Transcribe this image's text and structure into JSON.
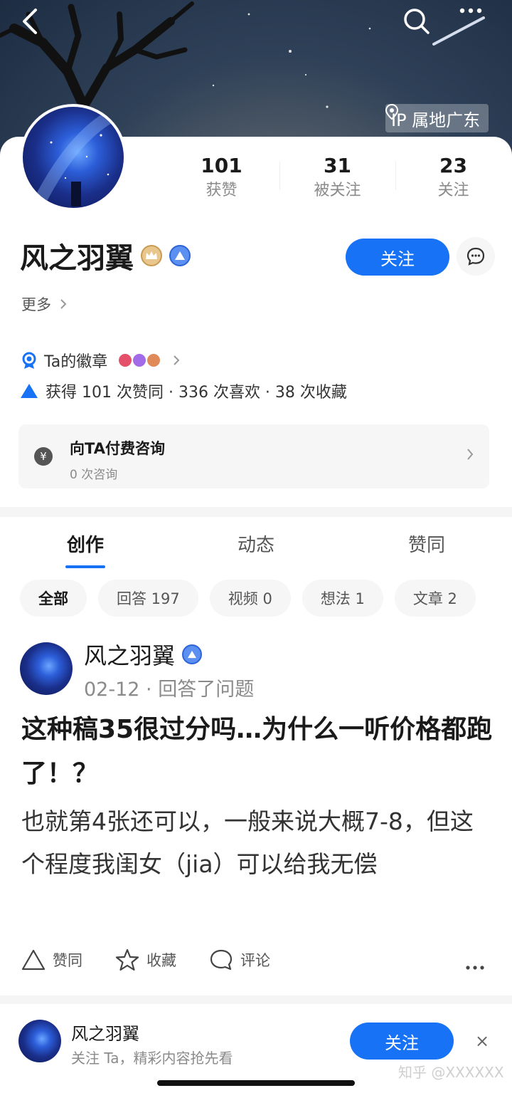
{
  "header": {
    "ip_location": "IP 属地广东"
  },
  "profile": {
    "name": "风之羽翼",
    "stats": [
      {
        "num": "101",
        "label": "获赞"
      },
      {
        "num": "31",
        "label": "被关注"
      },
      {
        "num": "23",
        "label": "关注"
      }
    ],
    "follow_label": "关注",
    "more_label": "更多"
  },
  "badges": {
    "label": "Ta的徽章",
    "stats_line": "获得 101 次赞同 · 336 次喜欢 · 38 次收藏",
    "badge_colors": [
      "#e4506a",
      "#a26be8",
      "#e08a5a"
    ]
  },
  "consult": {
    "icon_char": "¥",
    "title": "向TA付费咨询",
    "subtitle": "0 次咨询"
  },
  "tabs": [
    {
      "label": "创作",
      "active": true
    },
    {
      "label": "动态",
      "active": false
    },
    {
      "label": "赞同",
      "active": false
    }
  ],
  "chips": [
    {
      "label": "全部",
      "active": true
    },
    {
      "label": "回答 197",
      "active": false
    },
    {
      "label": "视频 0",
      "active": false
    },
    {
      "label": "想法 1",
      "active": false
    },
    {
      "label": "文章 2",
      "active": false
    }
  ],
  "post": {
    "author": "风之羽翼",
    "meta": "02-12 · 回答了问题",
    "title": "这种稿35很过分吗…为什么一听价格都跑了！？",
    "excerpt": "也就第4张还可以，一般来说大概7-8，但这个程度我闺女（jia）可以给我无偿",
    "actions": {
      "like": "赞同",
      "favorite": "收藏",
      "comment": "评论"
    }
  },
  "bottom_bar": {
    "name": "风之羽翼",
    "subtitle": "关注 Ta，精彩内容抢先看",
    "follow_label": "关注",
    "close": "×"
  },
  "watermark": "知乎 @XXXXXX",
  "colors": {
    "accent": "#1772f6"
  }
}
